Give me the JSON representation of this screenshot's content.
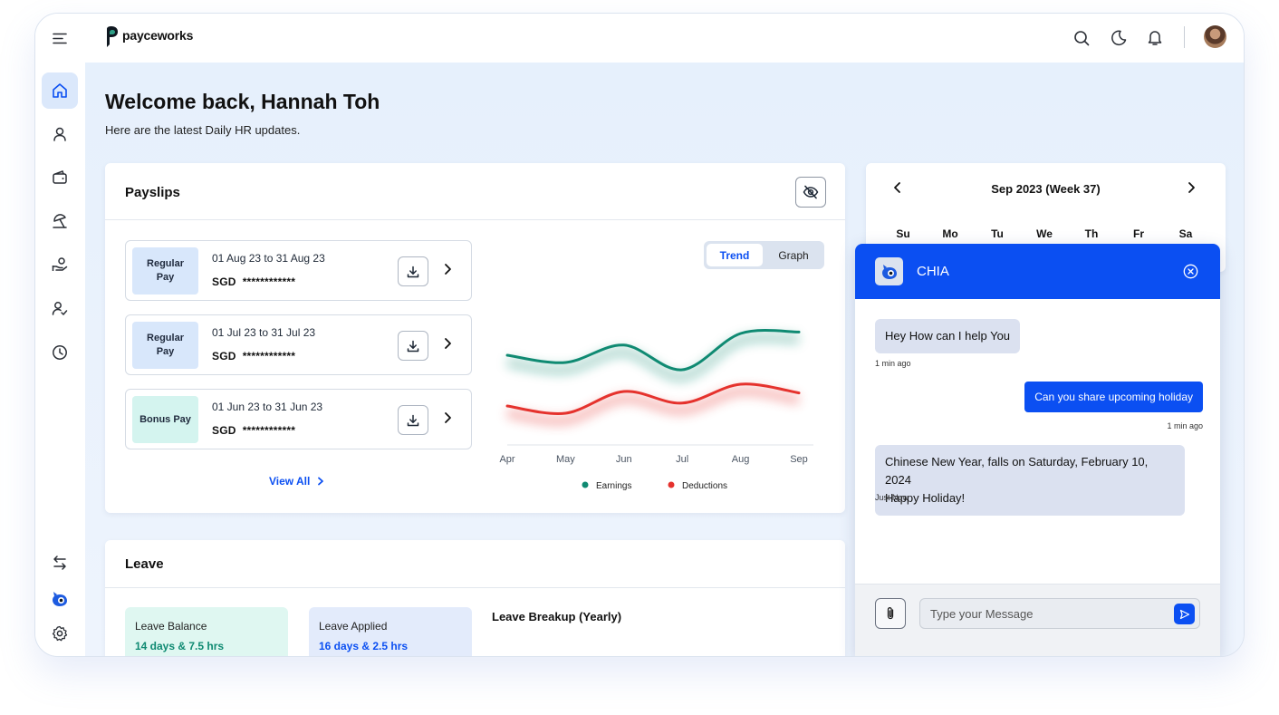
{
  "app": {
    "brand": "payceworks"
  },
  "colors": {
    "accent": "#0b4ff2",
    "earnings": "#0f8a72",
    "deductions": "#e5322d"
  },
  "header": {
    "icons": [
      "search-icon",
      "moon-icon",
      "bell-icon",
      "avatar"
    ]
  },
  "sidebar": {
    "items": [
      "home-icon",
      "user-icon",
      "wallet-icon",
      "umbrella-icon",
      "hand-coin-icon",
      "user-check-icon",
      "clock-icon"
    ],
    "bottom": [
      "swap-icon",
      "chia-bot-icon",
      "gear-icon"
    ]
  },
  "welcome": {
    "title": "Welcome back, Hannah Toh",
    "subtitle": "Here are the latest Daily HR updates."
  },
  "payslips": {
    "title": "Payslips",
    "rows": [
      {
        "badge": "Regular Pay",
        "badge_color": "#d8e7fb",
        "date": "01 Aug 23 to 31 Aug 23",
        "currency": "SGD",
        "amount": "************"
      },
      {
        "badge": "Regular Pay",
        "badge_color": "#d8e7fb",
        "date": "01 Jul 23 to 31 Jul 23",
        "currency": "SGD",
        "amount": "************"
      },
      {
        "badge": "Bonus Pay",
        "badge_color": "#d4f4ef",
        "date": "01 Jun 23 to 31 Jun 23",
        "currency": "SGD",
        "amount": "************"
      }
    ],
    "view_all": "View All",
    "toggle": {
      "trend": "Trend",
      "graph": "Graph",
      "selected": "Trend"
    }
  },
  "chart_data": {
    "type": "line",
    "categories": [
      "Apr",
      "May",
      "Jun",
      "Jul",
      "Aug",
      "Sep"
    ],
    "series": [
      {
        "name": "Earnings",
        "values": [
          0.55,
          0.5,
          0.62,
          0.45,
          0.7,
          0.71
        ]
      },
      {
        "name": "Deductions",
        "values": [
          0.2,
          0.15,
          0.3,
          0.22,
          0.35,
          0.29
        ]
      }
    ],
    "ylim": [
      0,
      1
    ],
    "grid": false,
    "legend": "bottom"
  },
  "leave": {
    "title": "Leave",
    "balance": {
      "label": "Leave Balance",
      "value": "14 days & 7.5 hrs"
    },
    "applied": {
      "label": "Leave Applied",
      "value": "16 days & 2.5 hrs"
    },
    "breakup_title": "Leave Breakup (Yearly)"
  },
  "calendar": {
    "title": "Sep 2023 (Week 37)",
    "days": [
      "Su",
      "Mo",
      "Tu",
      "We",
      "Th",
      "Fr",
      "Sa"
    ]
  },
  "chat": {
    "name": "CHIA",
    "messages": [
      {
        "from": "bot",
        "text": "Hey How can I help You",
        "time": "1 min ago"
      },
      {
        "from": "user",
        "text": "Can you share upcoming holiday",
        "time": "1 min ago"
      },
      {
        "from": "bot",
        "line1": "Chinese New Year, falls on Saturday, February 10, 2024",
        "line2": "Happy Holiday!",
        "time": "Just Now"
      }
    ],
    "input_placeholder": "Type your Message"
  }
}
